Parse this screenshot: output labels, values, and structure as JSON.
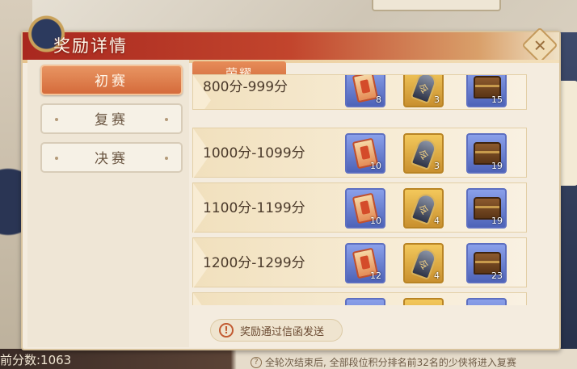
{
  "dialog": {
    "title": "奖励详情",
    "close_icon": "close-icon"
  },
  "side_tabs": [
    {
      "label": "初赛",
      "active": true
    },
    {
      "label": "复赛",
      "active": false
    },
    {
      "label": "决赛",
      "active": false
    }
  ],
  "category_tab": "荣耀",
  "rows": [
    {
      "label": "800分-999分",
      "items": [
        {
          "icon": "scroll-icon",
          "count": "8"
        },
        {
          "icon": "token-icon",
          "count": "3"
        },
        {
          "icon": "chest-icon",
          "count": "15"
        }
      ]
    },
    {
      "label": "1000分-1099分",
      "items": [
        {
          "icon": "scroll-icon",
          "count": "10"
        },
        {
          "icon": "token-icon",
          "count": "3"
        },
        {
          "icon": "chest-icon",
          "count": "19"
        }
      ]
    },
    {
      "label": "1100分-1199分",
      "items": [
        {
          "icon": "scroll-icon",
          "count": "10"
        },
        {
          "icon": "token-icon",
          "count": "4"
        },
        {
          "icon": "chest-icon",
          "count": "19"
        }
      ]
    },
    {
      "label": "1200分-1299分",
      "items": [
        {
          "icon": "scroll-icon",
          "count": "12"
        },
        {
          "icon": "token-icon",
          "count": "4"
        },
        {
          "icon": "chest-icon",
          "count": "23"
        }
      ]
    }
  ],
  "notice": "奖励通过信函发送",
  "footer": {
    "score": "前分数:1063",
    "note": "全轮次结束后, 全部段位积分排名前32名的少侠将进入复赛"
  },
  "colors": {
    "accent": "#d56b3b",
    "header_red": "#a9281f",
    "item_blue": "#5d6fc1",
    "item_gold": "#c9902f"
  }
}
